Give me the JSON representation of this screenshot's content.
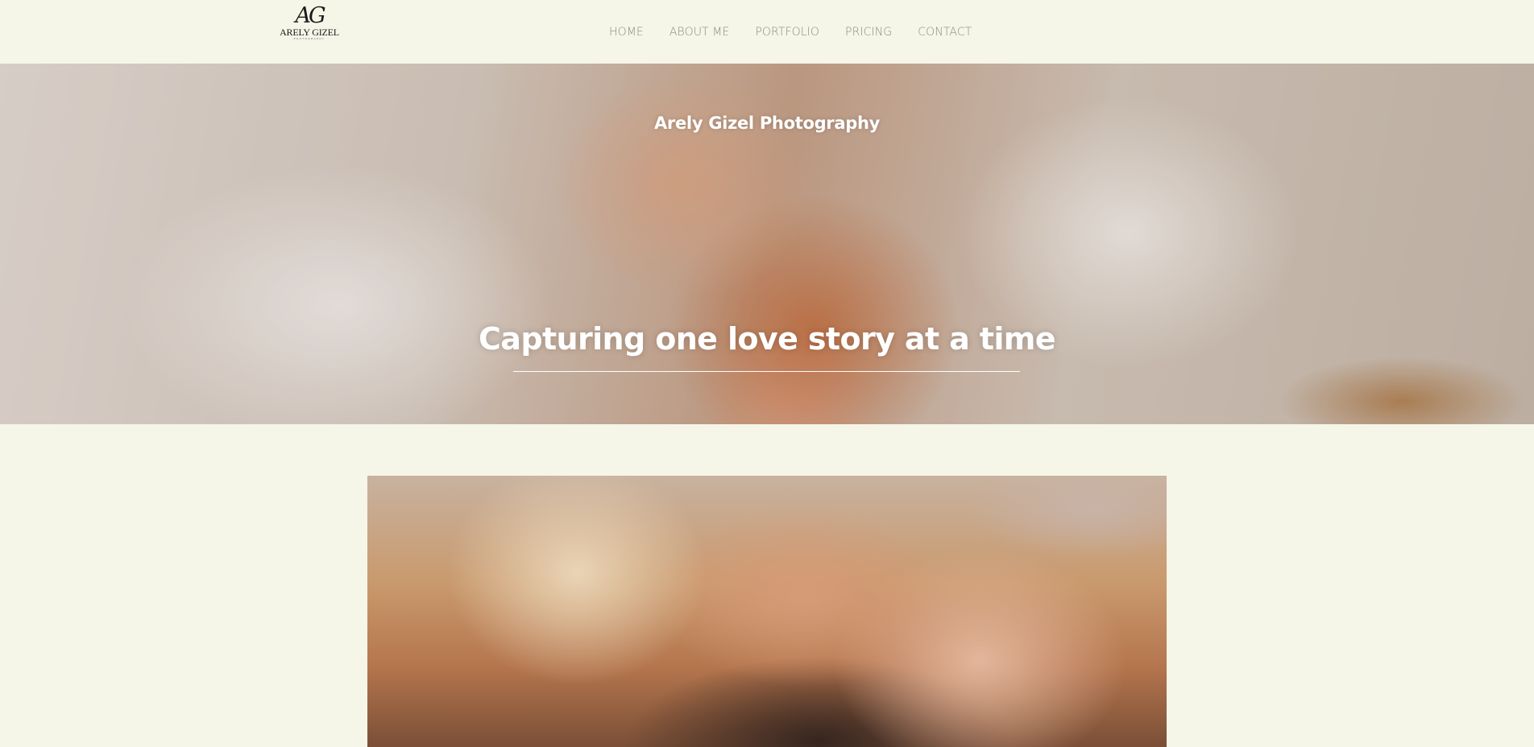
{
  "brand": {
    "logo_mark": "AG",
    "logo_name": "ARELY GIZEL",
    "logo_sub": "PHOTOGRAPHY"
  },
  "nav": {
    "items": [
      {
        "label": "HOME"
      },
      {
        "label": "ABOUT ME"
      },
      {
        "label": "PORTFOLIO"
      },
      {
        "label": "PRICING"
      },
      {
        "label": "CONTACT"
      }
    ]
  },
  "hero": {
    "subtitle": "Arely Gizel Photography",
    "title": "Capturing one love story at a time"
  },
  "colors": {
    "background": "#f5f5e8",
    "nav_text": "#8a8a82",
    "hero_text": "#ffffff"
  }
}
